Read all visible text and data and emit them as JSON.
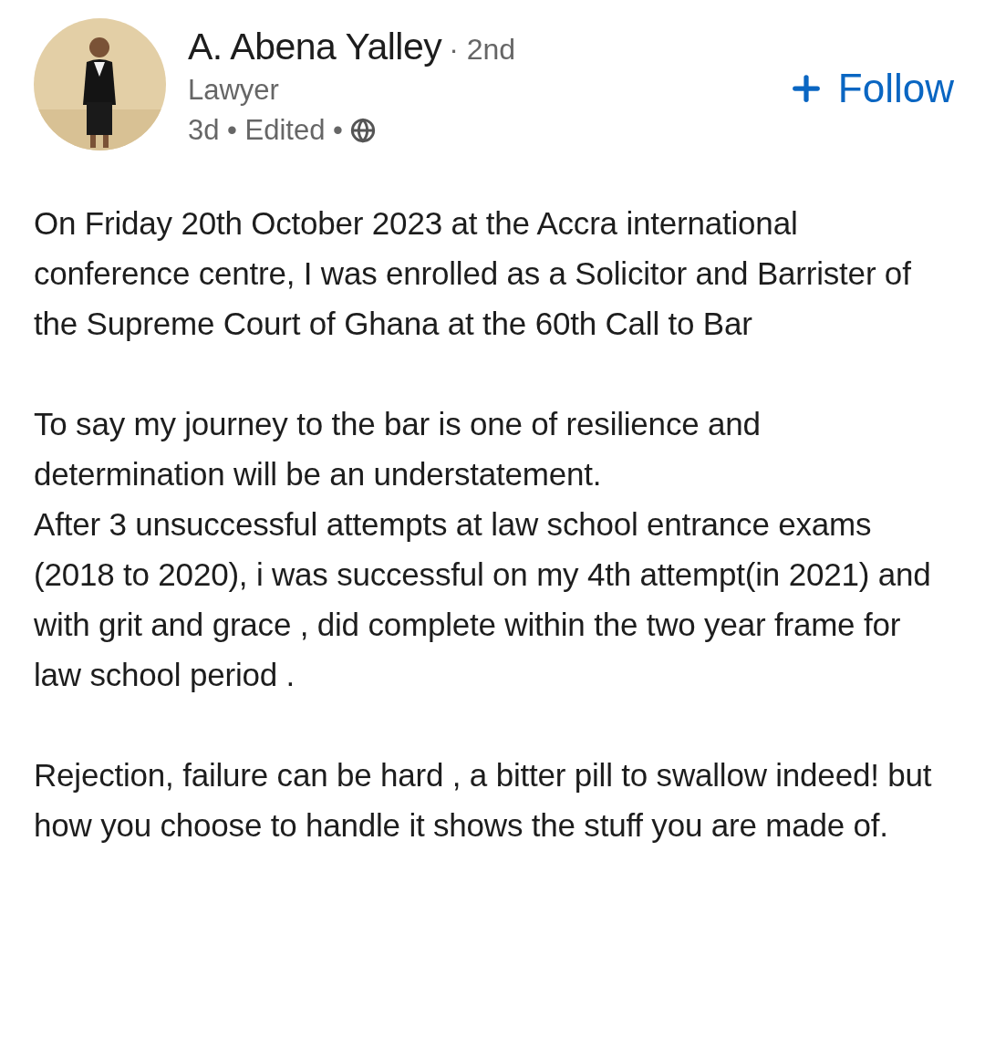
{
  "author": {
    "name": "A. Abena Yalley",
    "degree": "· 2nd",
    "headline": "Lawyer",
    "meta": "3d • Edited •"
  },
  "follow_button": {
    "label": "Follow"
  },
  "post": {
    "paragraphs": [
      "On Friday 20th October 2023 at the Accra international conference centre, I was enrolled as a Solicitor and Barrister of the Supreme Court of Ghana at the 60th Call to Bar",
      "To say my journey to the bar is one of resilience and determination will be an understatement.\nAfter 3 unsuccessful attempts at law school entrance exams (2018 to 2020), i was successful on my 4th attempt(in 2021) and with grit and grace , did complete within the two year frame for law school period .",
      "Rejection, failure can be hard , a bitter pill to swallow indeed! but how you choose to handle it shows the stuff you are made of."
    ]
  }
}
